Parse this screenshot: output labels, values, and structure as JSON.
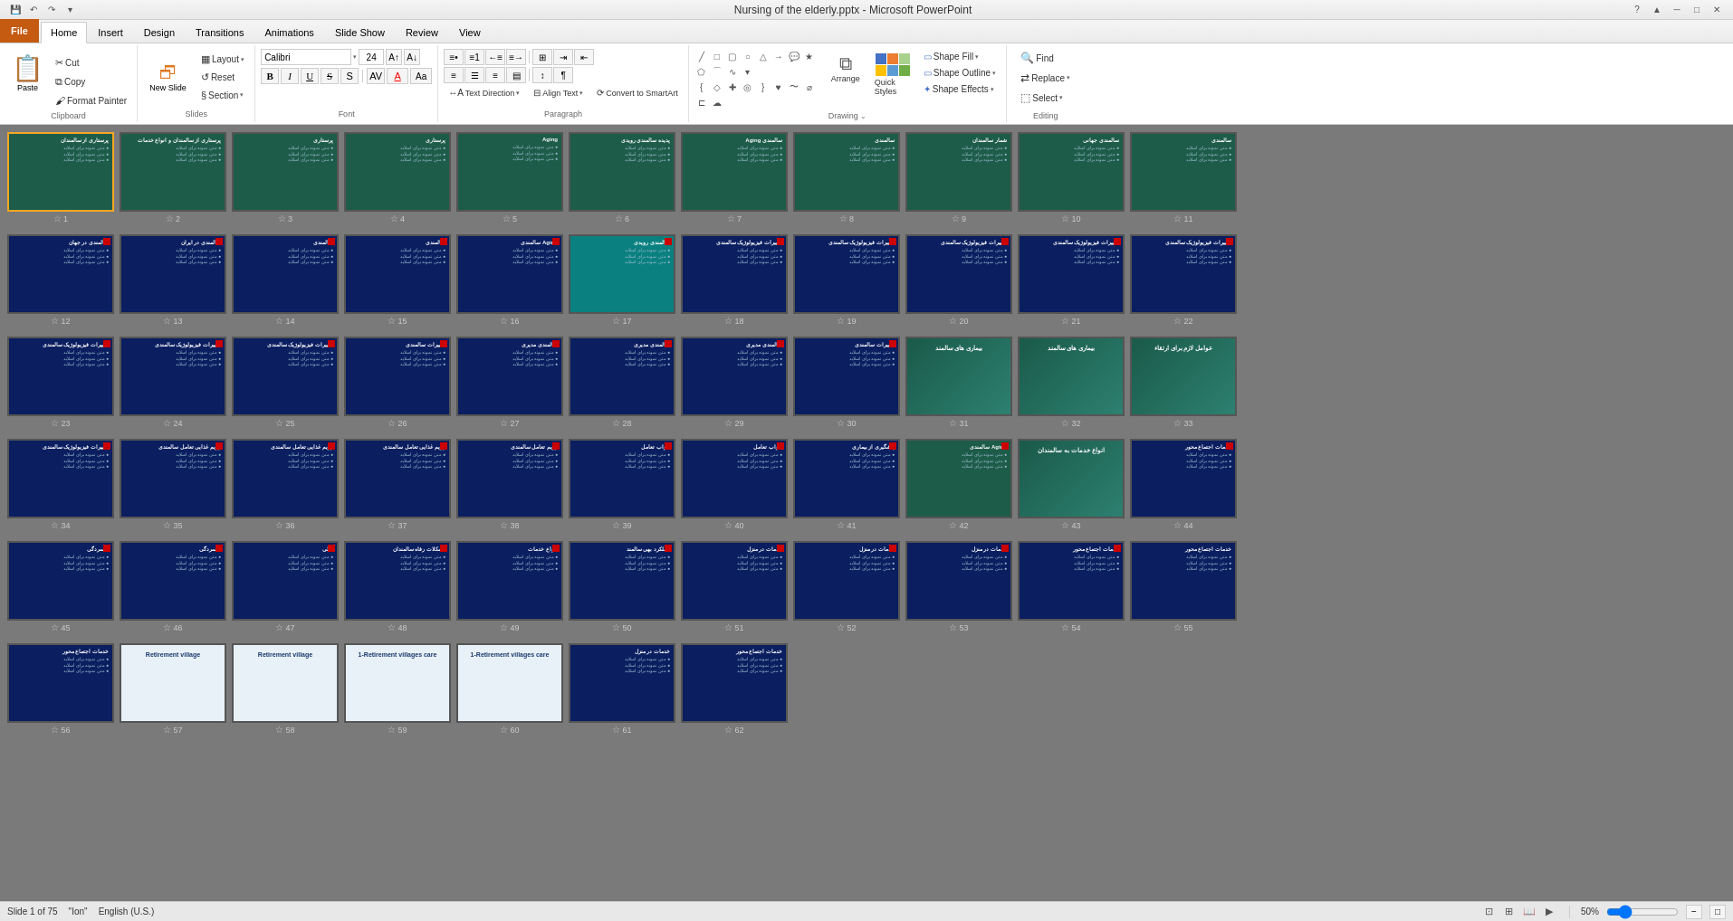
{
  "titlebar": {
    "title": "Nursing of the elderly.pptx - Microsoft PowerPoint",
    "quickaccess": [
      "save",
      "undo",
      "redo",
      "customize"
    ]
  },
  "ribbon": {
    "tabs": [
      "File",
      "Home",
      "Insert",
      "Design",
      "Transitions",
      "Animations",
      "Slide Show",
      "Review",
      "View"
    ],
    "active_tab": "Home",
    "groups": {
      "clipboard": {
        "label": "Clipboard",
        "paste": "Paste",
        "cut": "Cut",
        "copy": "Copy",
        "format_painter": "Format Painter"
      },
      "slides": {
        "label": "Slides",
        "new_slide": "New Slide",
        "layout": "Layout",
        "reset": "Reset",
        "section": "Section"
      },
      "font": {
        "label": "Font",
        "font_name": "Calibri",
        "font_size": "24",
        "bold": "B",
        "italic": "I",
        "underline": "U",
        "strikethrough": "S",
        "shadow": "S",
        "increase_size": "A↑",
        "decrease_size": "A↓",
        "font_color": "A",
        "clear": "Aa"
      },
      "paragraph": {
        "label": "Paragraph",
        "bullets": "≡•",
        "numbering": "≡1",
        "decrease_indent": "←≡",
        "increase_indent": "≡→",
        "add_remove_cols": "⊞",
        "align_left": "≡l",
        "center": "≡c",
        "align_right": "≡r",
        "justify": "≡j",
        "line_spacing": "↕",
        "text_direction": "Text Direction",
        "align_text": "Align Text",
        "convert_smartart": "Convert to SmartArt"
      },
      "drawing": {
        "label": "Drawing",
        "arrange": "Arrange",
        "quick_styles": "Quick Styles",
        "shape_fill": "Shape Fill",
        "shape_outline": "Shape Outline",
        "shape_effects": "Shape Effects"
      },
      "editing": {
        "label": "Editing",
        "find": "Find",
        "replace": "Replace",
        "select": "Select"
      }
    }
  },
  "slides": {
    "total": 75,
    "current": 1,
    "items": [
      {
        "num": 1,
        "bg": "dark-green",
        "selected": true,
        "title": "پرستاری از سالمندان"
      },
      {
        "num": 2,
        "bg": "dark-green",
        "selected": false,
        "title": "پرستاری از سالمندان و انواع خدمات"
      },
      {
        "num": 3,
        "bg": "dark-green",
        "selected": false,
        "title": "پرستاری"
      },
      {
        "num": 4,
        "bg": "dark-green",
        "selected": false,
        "title": "پرستاری"
      },
      {
        "num": 5,
        "bg": "dark-green",
        "selected": false,
        "title": "Aging"
      },
      {
        "num": 6,
        "bg": "dark-green",
        "selected": false,
        "title": "پدیده سالمندی رویدی"
      },
      {
        "num": 7,
        "bg": "dark-green",
        "selected": false,
        "title": "سالمندی Aging"
      },
      {
        "num": 8,
        "bg": "dark-green",
        "selected": false,
        "title": "سالمندی"
      },
      {
        "num": 9,
        "bg": "dark-green",
        "selected": false,
        "title": "شمار سالمندان"
      },
      {
        "num": 10,
        "bg": "dark-green",
        "selected": false,
        "title": "سالمندی جهانی"
      },
      {
        "num": 11,
        "bg": "dark-green",
        "selected": false,
        "title": "سالمندی"
      },
      {
        "num": 12,
        "bg": "blue",
        "selected": false,
        "title": "سالمندی در جهان"
      },
      {
        "num": 13,
        "bg": "blue",
        "selected": false,
        "title": "سالمندی در ایران"
      },
      {
        "num": 14,
        "bg": "blue",
        "selected": false,
        "title": "سالمندی"
      },
      {
        "num": 15,
        "bg": "blue",
        "selected": false,
        "title": "سالمندی"
      },
      {
        "num": 16,
        "bg": "blue",
        "selected": false,
        "title": "Aging سالمندی"
      },
      {
        "num": 17,
        "bg": "blue-light",
        "selected": false,
        "title": "سالمندی رویدی"
      },
      {
        "num": 18,
        "bg": "blue",
        "selected": false,
        "title": "تغییرات فیزیولوژیک سالمندی"
      },
      {
        "num": 19,
        "bg": "blue",
        "selected": false,
        "title": "تغییرات فیزیولوژیک سالمندی"
      },
      {
        "num": 20,
        "bg": "blue",
        "selected": false,
        "title": "تغییرات فیزیولوژیک سالمندی"
      },
      {
        "num": 21,
        "bg": "blue",
        "selected": false,
        "title": "تغییرات فیزیولوژیک سالمندی"
      },
      {
        "num": 22,
        "bg": "blue",
        "selected": false,
        "title": "تغییرات فیزیولوژیک سالمندی"
      },
      {
        "num": 23,
        "bg": "blue",
        "selected": false,
        "title": "تغییرات فیزیولوژیک سالمندی"
      },
      {
        "num": 24,
        "bg": "blue",
        "selected": false,
        "title": "تغییرات فیزیولوژیک سالمندی"
      },
      {
        "num": 25,
        "bg": "blue",
        "selected": false,
        "title": "تغییرات فیزیولوژیک سالمندی"
      },
      {
        "num": 26,
        "bg": "blue",
        "selected": false,
        "title": "تغییرات سالمندی"
      },
      {
        "num": 27,
        "bg": "blue",
        "selected": false,
        "title": "سالمندی مدیری"
      },
      {
        "num": 28,
        "bg": "blue",
        "selected": false,
        "title": "سالمندی مدیری"
      },
      {
        "num": 29,
        "bg": "blue",
        "selected": false,
        "title": "سالمندی مدیری"
      },
      {
        "num": 30,
        "bg": "blue",
        "selected": false,
        "title": "تغییرات سالمندی"
      },
      {
        "num": 31,
        "bg": "teal-gradient",
        "selected": false,
        "title": "بیماری های سالمند"
      },
      {
        "num": 32,
        "bg": "teal-gradient",
        "selected": false,
        "title": "بیماری های سالمند"
      },
      {
        "num": 33,
        "bg": "teal-gradient",
        "selected": false,
        "title": "عوامل لازم برای ارتقاء"
      },
      {
        "num": 34,
        "bg": "blue",
        "selected": false,
        "title": "تغییرات فیزیولوژیک سالمندی"
      },
      {
        "num": 35,
        "bg": "blue",
        "selected": false,
        "title": "رژیم غذایی تعامل سالمندی"
      },
      {
        "num": 36,
        "bg": "blue",
        "selected": false,
        "title": "رژیم غذایی تعامل سالمندی"
      },
      {
        "num": 37,
        "bg": "blue",
        "selected": false,
        "title": "رژیم غذایی تعامل سالمندی"
      },
      {
        "num": 38,
        "bg": "blue",
        "selected": false,
        "title": "رژیم تعامل سالمندی"
      },
      {
        "num": 39,
        "bg": "blue",
        "selected": false,
        "title": "خواب تعامل"
      },
      {
        "num": 40,
        "bg": "blue",
        "selected": false,
        "title": "خواب تعامل"
      },
      {
        "num": 41,
        "bg": "blue",
        "selected": false,
        "title": "پیشگیری از بیماری"
      },
      {
        "num": 42,
        "bg": "dark-green",
        "selected": false,
        "title": "Aging سالمندی"
      },
      {
        "num": 43,
        "bg": "teal-gradient",
        "selected": false,
        "title": "انواع خدمات به سالمندان"
      },
      {
        "num": 44,
        "bg": "blue",
        "selected": false,
        "title": "خدمات اجتماع محور"
      },
      {
        "num": 45,
        "bg": "blue",
        "selected": false,
        "title": "افسردگی"
      },
      {
        "num": 46,
        "bg": "blue",
        "selected": false,
        "title": "افسردگی"
      },
      {
        "num": 47,
        "bg": "blue",
        "selected": false,
        "title": "مالی"
      },
      {
        "num": 48,
        "bg": "blue",
        "selected": false,
        "title": "مشکلات رفاه سالمندان"
      },
      {
        "num": 49,
        "bg": "blue",
        "selected": false,
        "title": "انواع خدمات"
      },
      {
        "num": 50,
        "bg": "blue",
        "selected": false,
        "title": "عملکرد بهی سالمند"
      },
      {
        "num": 51,
        "bg": "blue",
        "selected": false,
        "title": "خدمات در منزل"
      },
      {
        "num": 52,
        "bg": "blue",
        "selected": false,
        "title": "خدمات در منزل"
      },
      {
        "num": 53,
        "bg": "blue",
        "selected": false,
        "title": "خدمات در منزل"
      },
      {
        "num": 54,
        "bg": "blue",
        "selected": false,
        "title": "خدمات اجتماع محور"
      },
      {
        "num": 55,
        "bg": "blue",
        "selected": false,
        "title": "خدمات اجتماع محور"
      },
      {
        "num": 56,
        "bg": "blue",
        "selected": false,
        "title": "خدمات اجتماع محور"
      },
      {
        "num": 57,
        "bg": "white-img",
        "selected": false,
        "title": "Retirement village"
      },
      {
        "num": 58,
        "bg": "white-img",
        "selected": false,
        "title": "Retirement village"
      },
      {
        "num": 59,
        "bg": "white-img",
        "selected": false,
        "title": "1-Retirement villages care"
      },
      {
        "num": 60,
        "bg": "white-img",
        "selected": false,
        "title": "1-Retirement villages care"
      },
      {
        "num": 61,
        "bg": "blue",
        "selected": false,
        "title": "خدمات در منزل"
      },
      {
        "num": 62,
        "bg": "blue",
        "selected": false,
        "title": "خدمات اجتماع محور"
      }
    ]
  },
  "statusbar": {
    "slide_info": "Slide 1 of 75",
    "language": "English (U.S.)",
    "notes": "Ion",
    "zoom": "50%"
  }
}
